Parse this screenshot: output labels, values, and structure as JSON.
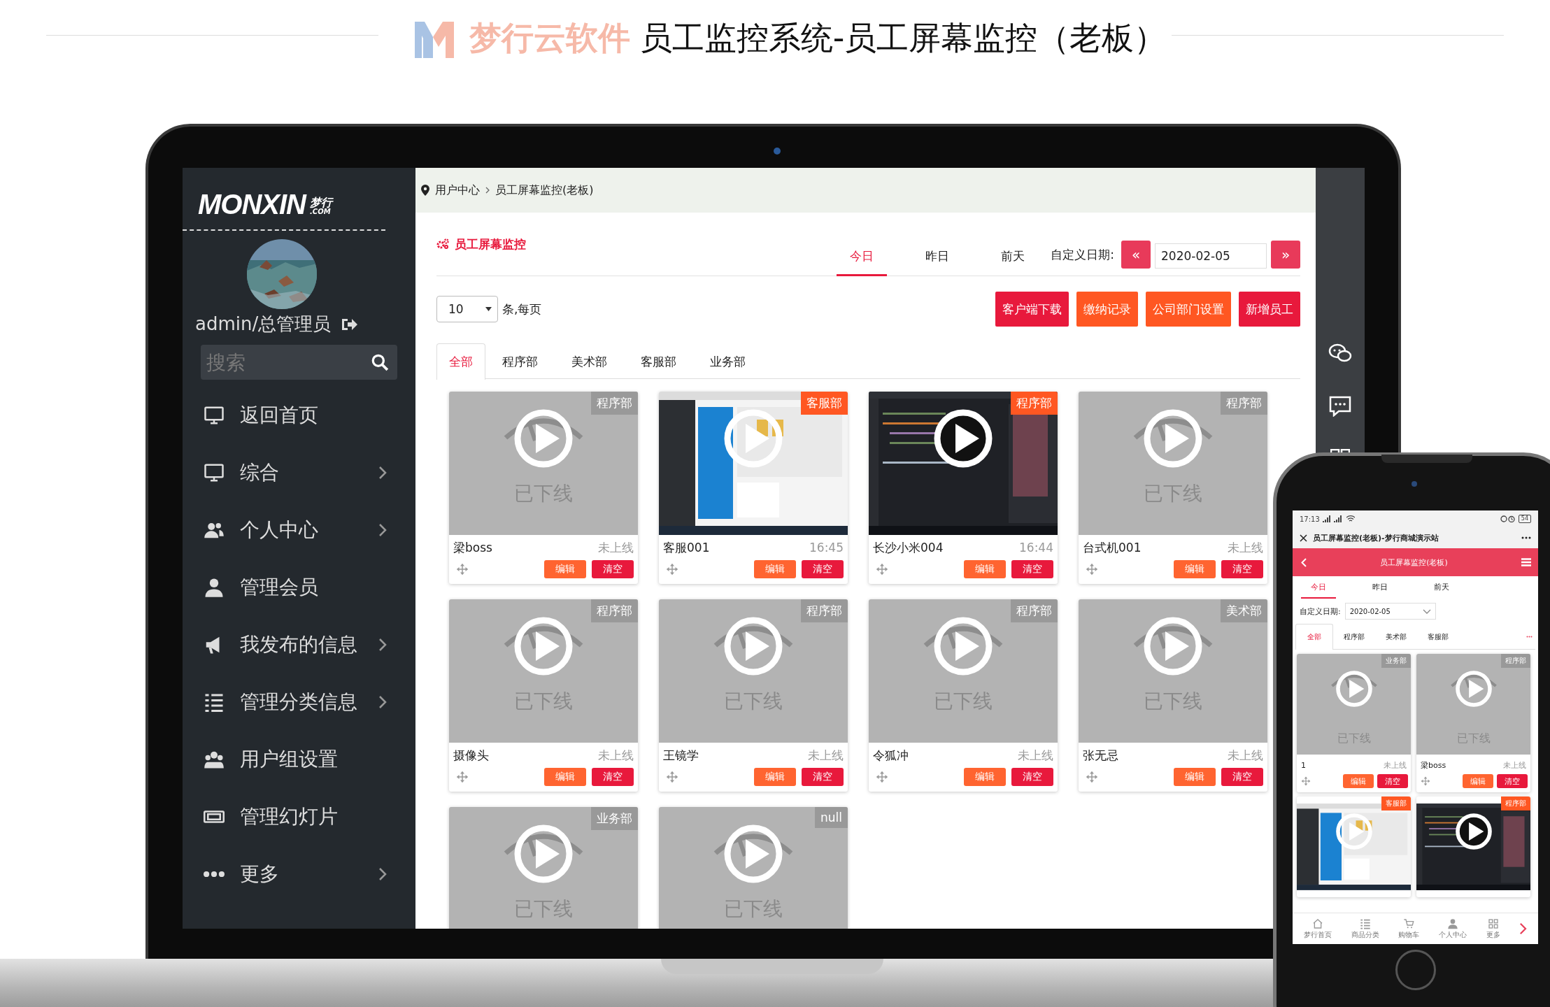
{
  "banner": {
    "brand": "梦行云软件",
    "title": "员工监控系统-员工屏幕监控（老板）"
  },
  "sidebar": {
    "logo": "MONXIN",
    "logo_mark": "梦行",
    "logo_domain": ".COM",
    "user": "admin/总管理员",
    "search_placeholder": "搜索",
    "menu": [
      {
        "label": "返回首页",
        "kind": "monitor",
        "has_arrow": false
      },
      {
        "label": "综合",
        "kind": "monitor",
        "has_arrow": true
      },
      {
        "label": "个人中心",
        "kind": "users",
        "has_arrow": true
      },
      {
        "label": "管理会员",
        "kind": "user",
        "has_arrow": false
      },
      {
        "label": "我发布的信息",
        "kind": "megaphone",
        "has_arrow": true
      },
      {
        "label": "管理分类信息",
        "kind": "list",
        "has_arrow": true
      },
      {
        "label": "用户组设置",
        "kind": "group",
        "has_arrow": false
      },
      {
        "label": "管理幻灯片",
        "kind": "slides",
        "has_arrow": false
      },
      {
        "label": "更多",
        "kind": "dots",
        "has_arrow": true
      }
    ]
  },
  "breadcrumb": [
    "用户中心",
    "员工屏幕监控(老板)"
  ],
  "heading": "员工屏幕监控",
  "day_tabs": [
    {
      "label": "今日",
      "selected": true
    },
    {
      "label": "昨日",
      "selected": false
    },
    {
      "label": "前天",
      "selected": false
    }
  ],
  "date_filter": {
    "label": "自定义日期:",
    "prev": "«",
    "value": "2020-02-05",
    "next": "»"
  },
  "per_page": {
    "value": "10",
    "suffix": "条,每页"
  },
  "actions": [
    {
      "label": "客户端下载",
      "color": "#e8193c"
    },
    {
      "label": "缴纳记录",
      "color": "#ff5722"
    },
    {
      "label": "公司部门设置",
      "color": "#ff5722"
    },
    {
      "label": "新增员工",
      "color": "#e8193c"
    }
  ],
  "dept_tabs": [
    {
      "label": "全部",
      "selected": true
    },
    {
      "label": "程序部",
      "selected": false
    },
    {
      "label": "美术部",
      "selected": false
    },
    {
      "label": "客服部",
      "selected": false
    },
    {
      "label": "业务部",
      "selected": false
    }
  ],
  "cards": [
    {
      "dept": "程序部",
      "online": false,
      "kind": "offline",
      "offline_text": "已下线",
      "name": "梁boss",
      "status": "未上线",
      "buttons": [
        "编辑",
        "清空"
      ]
    },
    {
      "dept": "客服部",
      "online": true,
      "kind": "light_screen",
      "name": "客服001",
      "status": "16:45",
      "buttons": [
        "编辑",
        "清空"
      ]
    },
    {
      "dept": "程序部",
      "online": true,
      "kind": "dark_screen",
      "name": "长沙小米004",
      "status": "16:44",
      "buttons": [
        "编辑",
        "清空"
      ]
    },
    {
      "dept": "程序部",
      "online": false,
      "kind": "offline",
      "offline_text": "已下线",
      "name": "台式机001",
      "status": "未上线",
      "buttons": [
        "编辑",
        "清空"
      ]
    },
    {
      "dept": "程序部",
      "online": false,
      "kind": "offline",
      "offline_text": "已下线",
      "name": "摄像头",
      "status": "未上线",
      "buttons": [
        "编辑",
        "清空"
      ]
    },
    {
      "dept": "程序部",
      "online": false,
      "kind": "offline",
      "offline_text": "已下线",
      "name": "王镜学",
      "status": "未上线",
      "buttons": [
        "编辑",
        "清空"
      ]
    },
    {
      "dept": "程序部",
      "online": false,
      "kind": "offline",
      "offline_text": "已下线",
      "name": "令狐冲",
      "status": "未上线",
      "buttons": [
        "编辑",
        "清空"
      ]
    },
    {
      "dept": "美术部",
      "online": false,
      "kind": "offline",
      "offline_text": "已下线",
      "name": "张无忌",
      "status": "未上线",
      "buttons": [
        "编辑",
        "清空"
      ]
    },
    {
      "dept": "业务部",
      "online": false,
      "kind": "offline",
      "offline_text": "已下线"
    },
    {
      "dept": "null",
      "online": false,
      "kind": "offline",
      "offline_text": "已下线"
    }
  ],
  "phone": {
    "time": "17:13",
    "battery": "54",
    "page_title": "员工屏幕监控(老板)-梦行商城演示站",
    "header_title": "员工屏幕监控(老板)",
    "day_tabs": [
      {
        "label": "今日",
        "selected": true
      },
      {
        "label": "昨日",
        "selected": false
      },
      {
        "label": "前天",
        "selected": false
      }
    ],
    "date_label": "自定义日期:",
    "date_value": "2020-02-05",
    "dept_tabs": [
      {
        "label": "全部",
        "selected": true
      },
      {
        "label": "程序部",
        "selected": false
      },
      {
        "label": "美术部",
        "selected": false
      },
      {
        "label": "客服部",
        "selected": false
      }
    ],
    "cards": [
      {
        "dept": "业务部",
        "online": false,
        "kind": "offline",
        "offline_text": "已下线",
        "name": "1",
        "status": "未上线",
        "buttons": [
          "编辑",
          "清空"
        ]
      },
      {
        "dept": "程序部",
        "online": false,
        "kind": "offline",
        "offline_text": "已下线",
        "name": "梁boss",
        "status": "未上线",
        "buttons": [
          "编辑",
          "清空"
        ]
      },
      {
        "dept": "客服部",
        "online": true,
        "kind": "light_screen"
      },
      {
        "dept": "程序部",
        "online": true,
        "kind": "dark_screen"
      }
    ],
    "nav": [
      {
        "label": "梦行首页",
        "kind": "home"
      },
      {
        "label": "商品分类",
        "kind": "list"
      },
      {
        "label": "购物车",
        "kind": "cart"
      },
      {
        "label": "个人中心",
        "kind": "user"
      },
      {
        "label": "更多",
        "kind": "grid"
      }
    ]
  }
}
